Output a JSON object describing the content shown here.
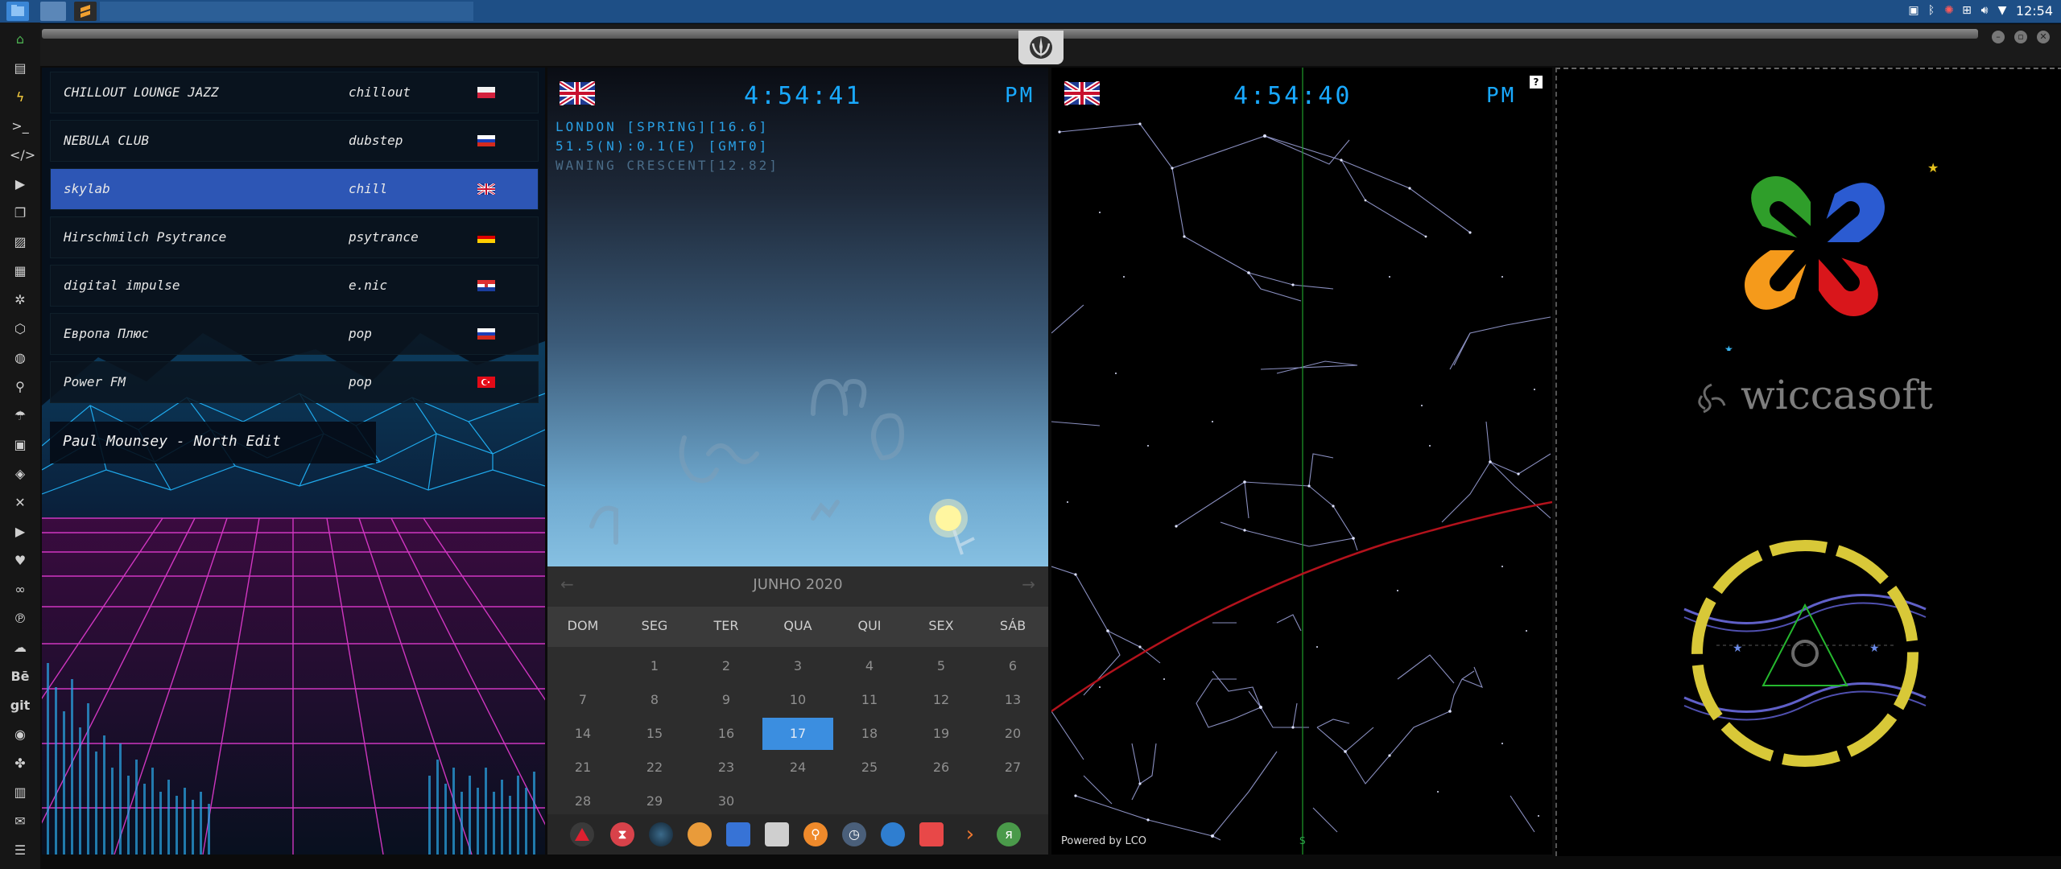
{
  "system": {
    "clock": "12:54"
  },
  "radio": {
    "stations": [
      {
        "name": "CHILLOUT LOUNGE JAZZ",
        "genre": "chillout",
        "flag": "poland"
      },
      {
        "name": "NEBULA CLUB",
        "genre": "dubstep",
        "flag": "russia"
      },
      {
        "name": "skylab",
        "genre": "chill",
        "flag": "uk"
      },
      {
        "name": "Hirschmilch Psytrance",
        "genre": "psytrance",
        "flag": "germany"
      },
      {
        "name": "digital impulse",
        "genre": "e.nic",
        "flag": "croatia"
      },
      {
        "name": "Европа Плюс",
        "genre": "pop",
        "flag": "russia"
      },
      {
        "name": "Power FM",
        "genre": "pop",
        "flag": "turkey"
      }
    ],
    "selected_index": 2,
    "now_playing": "Paul Mounsey - North Edit"
  },
  "clock_widget": {
    "time": "4:54:41",
    "ampm": "PM",
    "location_line": "LONDON [SPRING][16.6]",
    "coords_line": "51.5(N):0.1(E) [GMT0]",
    "moon_line": "WANING CRESCENT[12.82]"
  },
  "calendar": {
    "month_label": "JUNHO 2020",
    "weekdays": [
      "DOM",
      "SEG",
      "TER",
      "QUA",
      "QUI",
      "SEX",
      "SÁB"
    ],
    "weeks": [
      [
        "",
        "1",
        "2",
        "3",
        "4",
        "5",
        "6"
      ],
      [
        "7",
        "8",
        "9",
        "10",
        "11",
        "12",
        "13"
      ],
      [
        "14",
        "15",
        "16",
        "17",
        "18",
        "19",
        "20"
      ],
      [
        "21",
        "22",
        "23",
        "24",
        "25",
        "26",
        "27"
      ],
      [
        "28",
        "29",
        "30",
        "",
        "",
        "",
        ""
      ]
    ],
    "today": "17"
  },
  "sky_widget": {
    "time": "4:54:40",
    "ampm": "PM",
    "help": "?",
    "credit": "Powered by LCO",
    "south_label": "S"
  },
  "brand": {
    "name": "wiccasoft"
  },
  "colors": {
    "accent_blue": "#19a9ff",
    "selection": "#2d56b5",
    "today": "#3b8ee0",
    "ecliptic": "#b3121c",
    "meridian": "#1f9d2a"
  }
}
